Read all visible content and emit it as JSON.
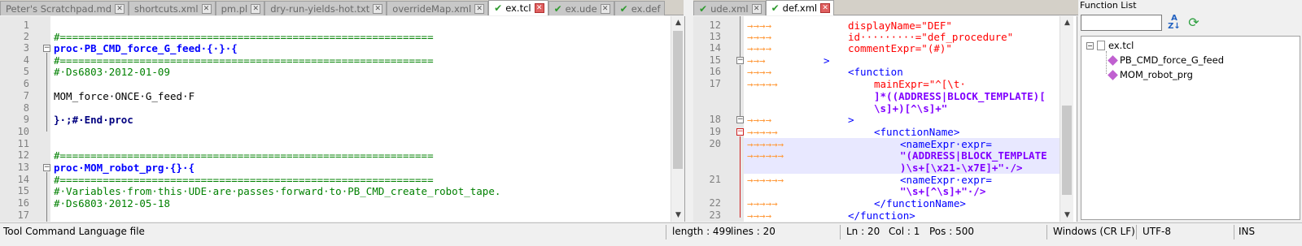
{
  "left_tabs": [
    {
      "label": "Peter's Scratchpad.md",
      "active": false
    },
    {
      "label": "shortcuts.xml",
      "active": false
    },
    {
      "label": "pm.pl",
      "active": false
    },
    {
      "label": "dry-run-yields-hot.txt",
      "active": false
    },
    {
      "label": "overrideMap.xml",
      "active": false
    },
    {
      "label": "ex.tcl",
      "active": true
    },
    {
      "label": "ex.ude",
      "active": false
    },
    {
      "label": "ex.def",
      "active": false
    }
  ],
  "right_tabs": [
    {
      "label": "ude.xml",
      "active": false
    },
    {
      "label": "def.xml",
      "active": true
    }
  ],
  "left_editor": {
    "line_numbers": [
      "1",
      "2",
      "3",
      "4",
      "5",
      "6",
      "7",
      "8",
      "9",
      "10",
      "11",
      "12",
      "13",
      "14",
      "15",
      "16",
      "17"
    ],
    "lines": [
      "",
      "#=============================================================",
      "proc·PB_CMD_force_G_feed·{·}·{",
      "#=============================================================",
      "#·Ds6803·2012-01-09",
      "",
      "MOM_force·ONCE·G_feed·F",
      "",
      "}·;#·End·proc",
      "",
      "",
      "#=============================================================",
      "proc·MOM_robot_prg·{}·{",
      "#=============================================================",
      "#·Variables·from·this·UDE·are·passes·forward·to·PB_CMD_create_robot_tape.",
      "#·Ds6803·2012-05-18",
      ""
    ]
  },
  "right_editor": {
    "line_numbers": [
      "12",
      "13",
      "14",
      "15",
      "16",
      "17",
      "",
      "",
      "18",
      "19",
      "20",
      "",
      "21",
      "",
      "22",
      "23"
    ],
    "lines": [
      "displayName=\"DEF\"",
      "id·········=\"def_procedure\"",
      "commentExpr=\"(#)\"",
      ">",
      "<function",
      "mainExpr=\"^[\\t·",
      "]*((ADDRESS|BLOCK_TEMPLATE)[",
      "\\s]+)[^\\s]+\"",
      ">",
      "<functionName>",
      "<nameExpr·expr=",
      "\"(ADDRESS|BLOCK_TEMPLATE",
      ")\\s+[\\x21-\\x7E]+\"·/>",
      "<nameExpr·expr=",
      "\"\\s+[^\\s]+\"·/>",
      "</functionName>",
      "</function>"
    ]
  },
  "function_list": {
    "title": "Function List",
    "search_value": "",
    "root": "ex.tcl",
    "items": [
      "PB_CMD_force_G_feed",
      "MOM_robot_prg"
    ]
  },
  "status_bar": {
    "file_type": "Tool Command Language file",
    "length": "length : 499",
    "lines": "lines : 20",
    "ln": "Ln : 20",
    "col": "Col : 1",
    "pos": "Pos : 500",
    "eol": "Windows (CR LF)",
    "encoding": "UTF-8",
    "mode": "INS"
  }
}
